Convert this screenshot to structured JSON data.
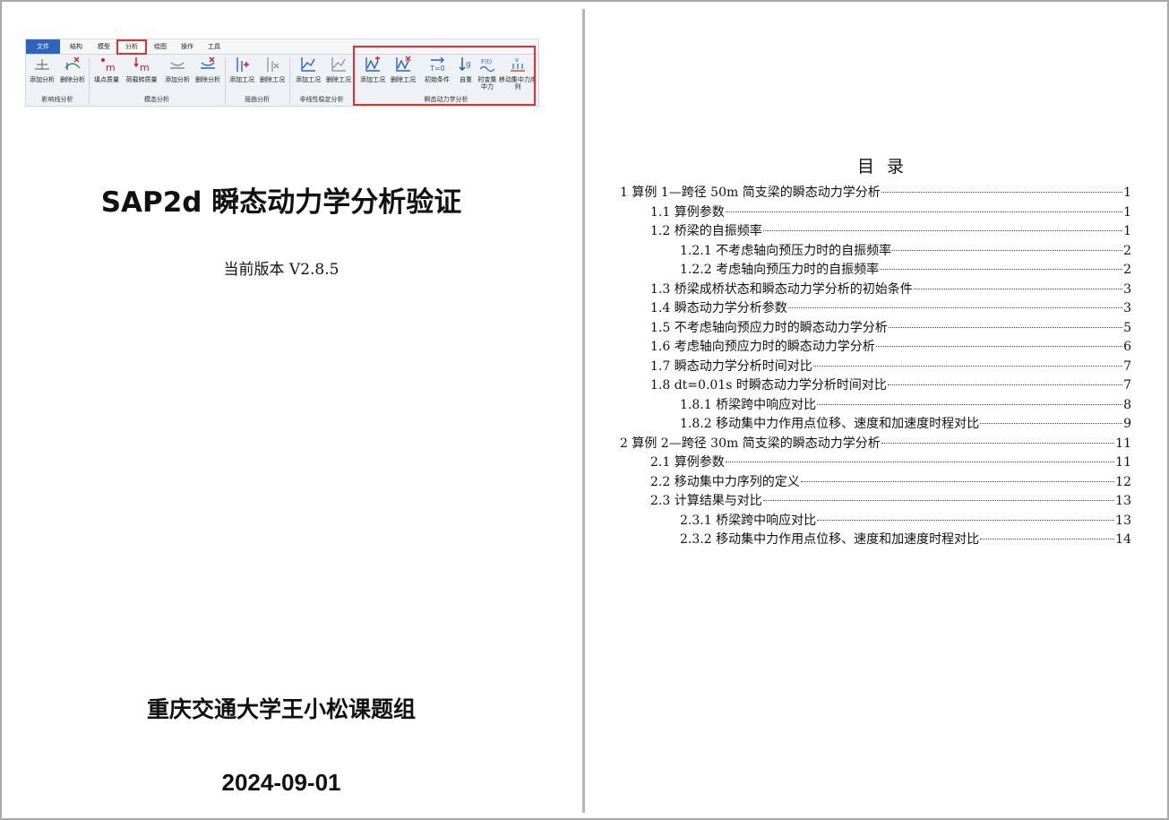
{
  "ribbon": {
    "tabs": [
      "文件",
      "结构",
      "模型",
      "分析",
      "绘图",
      "操作",
      "工具"
    ],
    "buttons": [
      {
        "label": "添加分析",
        "icon": "influence-add-icon"
      },
      {
        "label": "删除分析",
        "icon": "influence-delete-icon"
      },
      {
        "label": "填点质量",
        "icon": "point-mass-icon"
      },
      {
        "label": "荷载转质量",
        "icon": "load-to-mass-icon"
      },
      {
        "label": "添加分析",
        "icon": "modal-add-icon"
      },
      {
        "label": "删除分析",
        "icon": "modal-delete-icon"
      },
      {
        "label": "添加工况",
        "icon": "buckling-add-icon"
      },
      {
        "label": "删除工况",
        "icon": "buckling-delete-icon"
      },
      {
        "label": "添加工况",
        "icon": "nonlinear-add-icon"
      },
      {
        "label": "删除工况",
        "icon": "nonlinear-delete-icon"
      },
      {
        "label": "添加工况",
        "icon": "transient-add-icon"
      },
      {
        "label": "删除工况",
        "icon": "transient-delete-icon"
      },
      {
        "label": "初始条件",
        "icon": "initial-condition-icon"
      },
      {
        "label": "自重",
        "icon": "self-weight-icon"
      },
      {
        "label": "时变集中力",
        "icon": "time-force-icon"
      },
      {
        "label": "移动集中力序列",
        "icon": "moving-force-icon"
      }
    ],
    "groups": [
      "影响线分析",
      "模态分析",
      "屈曲分析",
      "非线性稳定分析",
      "瞬态动力学分析"
    ]
  },
  "cover": {
    "title": "SAP2d 瞬态动力学分析验证",
    "version": "当前版本  V2.8.5",
    "organization": "重庆交通大学王小松课题组",
    "date": "2024-09-01"
  },
  "toc": {
    "title": "目录",
    "entries": [
      {
        "level": 1,
        "text": "1  算例 1—跨径 50m 简支梁的瞬态动力学分析",
        "page": "1"
      },
      {
        "level": 2,
        "text": "1.1  算例参数",
        "page": "1"
      },
      {
        "level": 2,
        "text": "1.2  桥梁的自振频率",
        "page": "1"
      },
      {
        "level": 3,
        "text": "1.2.1  不考虑轴向预压力时的自振频率",
        "page": "2"
      },
      {
        "level": 3,
        "text": "1.2.2  考虑轴向预压力时的自振频率",
        "page": "2"
      },
      {
        "level": 2,
        "text": "1.3  桥梁成桥状态和瞬态动力学分析的初始条件",
        "page": "3"
      },
      {
        "level": 2,
        "text": "1.4  瞬态动力学分析参数",
        "page": "3"
      },
      {
        "level": 2,
        "text": "1.5  不考虑轴向预应力时的瞬态动力学分析",
        "page": "5"
      },
      {
        "level": 2,
        "text": "1.6  考虑轴向预应力时的瞬态动力学分析",
        "page": "6"
      },
      {
        "level": 2,
        "text": "1.7  瞬态动力学分析时间对比",
        "page": "7"
      },
      {
        "level": 2,
        "text": "1.8 dt=0.01s 时瞬态动力学分析时间对比",
        "page": "7"
      },
      {
        "level": 3,
        "text": "1.8.1  桥梁跨中响应对比",
        "page": "8"
      },
      {
        "level": 3,
        "text": "1.8.2  移动集中力作用点位移、速度和加速度时程对比",
        "page": "9"
      },
      {
        "level": 1,
        "text": "2  算例 2—跨径 30m 简支梁的瞬态动力学分析",
        "page": "11"
      },
      {
        "level": 2,
        "text": "2.1  算例参数",
        "page": "11"
      },
      {
        "level": 2,
        "text": "2.2  移动集中力序列的定义",
        "page": "12"
      },
      {
        "level": 2,
        "text": "2.3  计算结果与对比",
        "page": "13"
      },
      {
        "level": 3,
        "text": "2.3.1  桥梁跨中响应对比",
        "page": "13"
      },
      {
        "level": 3,
        "text": "2.3.2  移动集中力作用点位移、速度和加速度时程对比",
        "page": "14"
      }
    ]
  }
}
